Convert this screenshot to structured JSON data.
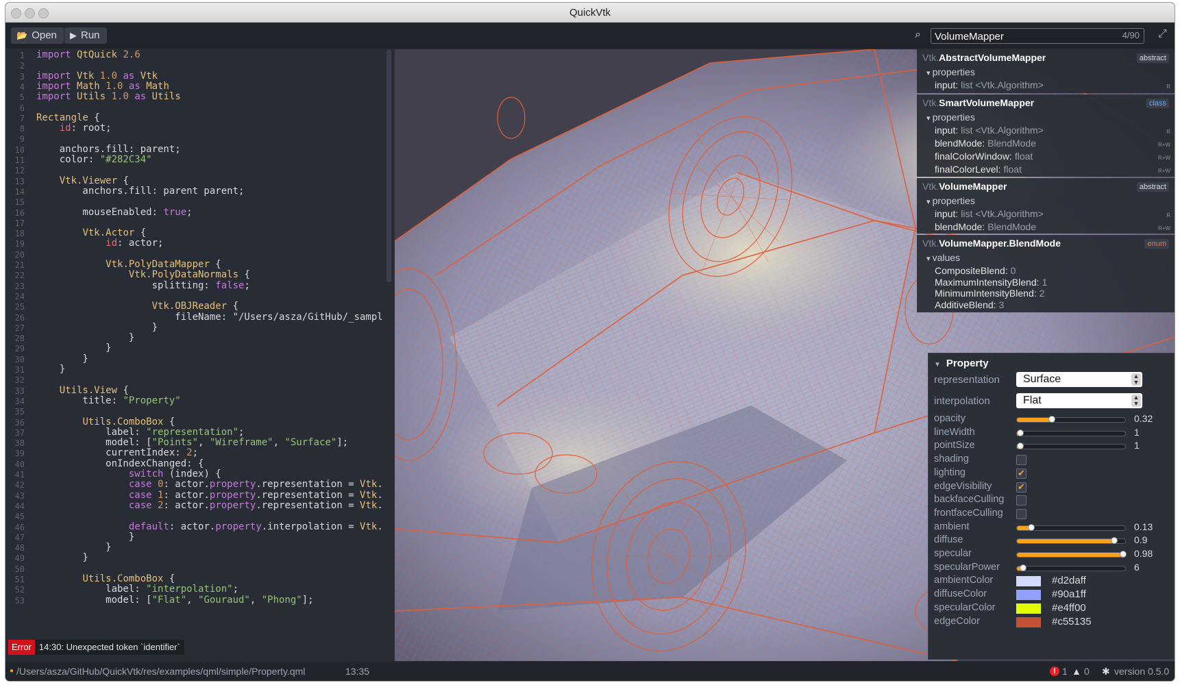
{
  "window": {
    "title": "QuickVtk"
  },
  "toolbar": {
    "open_label": "Open",
    "run_label": "Run"
  },
  "search": {
    "value": "VolumeMapper",
    "count": "4/90"
  },
  "editor": {
    "lines": [
      "import QtQuick 2.6",
      "",
      "import Vtk 1.0 as Vtk",
      "import Math 1.0 as Math",
      "import Utils 1.0 as Utils",
      "",
      "Rectangle {",
      "    id: root;",
      "",
      "    anchors.fill: parent;",
      "    color: \"#282C34\"",
      "",
      "    Vtk.Viewer {",
      "        anchors.fill: parent parent;",
      "",
      "        mouseEnabled: true;",
      "",
      "        Vtk.Actor {",
      "            id: actor;",
      "",
      "            Vtk.PolyDataMapper {",
      "                Vtk.PolyDataNormals {",
      "                    splitting: false;",
      "",
      "                    Vtk.OBJReader {",
      "                        fileName: \"/Users/asza/GitHub/_sampl",
      "                    }",
      "                }",
      "            }",
      "        }",
      "    }",
      "",
      "    Utils.View {",
      "        title: \"Property\"",
      "",
      "        Utils.ComboBox {",
      "            label: \"representation\";",
      "            model: [\"Points\", \"Wireframe\", \"Surface\"];",
      "            currentIndex: 2;",
      "            onIndexChanged: {",
      "                switch (index) {",
      "                case 0: actor.property.representation = Vtk.",
      "                case 1: actor.property.representation = Vtk.",
      "                case 2: actor.property.representation = Vtk.",
      "",
      "                default: actor.property.interpolation = Vtk.",
      "                }",
      "            }",
      "        }",
      "",
      "        Utils.ComboBox {",
      "            label: \"interpolation\";",
      "            model: [\"Flat\", \"Gouraud\", \"Phong\"];"
    ]
  },
  "error": {
    "label": "Error",
    "message": "14:30: Unexpected token `identifier`"
  },
  "statusbar": {
    "path": "/Users/asza/GitHub/QuickVtk/res/examples/qml/simple/Property.qml",
    "cursor": "13:35",
    "errors": "1",
    "warnings": "0",
    "version": "version 0.5.0"
  },
  "docs": [
    {
      "prefix": "Vtk.",
      "name": "AbstractVolumeMapper",
      "badge": "abstract",
      "badge_color": "#d7dae0",
      "section": "properties",
      "rows": [
        {
          "name": "input:",
          "type": "list <Vtk.Algorithm>",
          "rw": "R"
        }
      ]
    },
    {
      "prefix": "Vtk.",
      "name": "SmartVolumeMapper",
      "badge": "class",
      "badge_color": "#61afef",
      "section": "properties",
      "rows": [
        {
          "name": "input:",
          "type": "list <Vtk.Algorithm>",
          "rw": "R"
        },
        {
          "name": "blendMode:",
          "type": "BlendMode",
          "rw": "R+W"
        },
        {
          "name": "finalColorWindow:",
          "type": "float",
          "rw": "R+W"
        },
        {
          "name": "finalColorLevel:",
          "type": "float",
          "rw": "R+W"
        }
      ]
    },
    {
      "prefix": "Vtk.",
      "name": "VolumeMapper",
      "badge": "abstract",
      "badge_color": "#d7dae0",
      "section": "properties",
      "rows": [
        {
          "name": "input:",
          "type": "list <Vtk.Algorithm>",
          "rw": "R"
        },
        {
          "name": "blendMode:",
          "type": "BlendMode",
          "rw": "R+W"
        }
      ]
    },
    {
      "prefix": "Vtk.",
      "name": "VolumeMapper.BlendMode",
      "badge": "enum",
      "badge_color": "#e8743b",
      "section": "values",
      "rows": [
        {
          "name": "CompositeBlend:",
          "type": "0",
          "rw": ""
        },
        {
          "name": "MaximumIntensityBlend:",
          "type": "1",
          "rw": ""
        },
        {
          "name": "MinimumIntensityBlend:",
          "type": "2",
          "rw": ""
        },
        {
          "name": "AdditiveBlend:",
          "type": "3",
          "rw": ""
        }
      ]
    }
  ],
  "property": {
    "title": "Property",
    "combos": [
      {
        "label": "representation",
        "value": "Surface"
      },
      {
        "label": "interpolation",
        "value": "Flat"
      }
    ],
    "sliders": [
      {
        "label": "opacity",
        "value": "0.32",
        "fraction": 0.32
      },
      {
        "label": "lineWidth",
        "value": "1",
        "fraction": 0.0
      },
      {
        "label": "pointSize",
        "value": "1",
        "fraction": 0.0
      },
      {
        "label": "shading",
        "checkbox": false
      },
      {
        "label": "lighting",
        "checkbox": true
      },
      {
        "label": "edgeVisibility",
        "checkbox": true
      },
      {
        "label": "backfaceCulling",
        "checkbox": false
      },
      {
        "label": "frontfaceCulling",
        "checkbox": false
      },
      {
        "label": "ambient",
        "value": "0.13",
        "fraction": 0.13
      },
      {
        "label": "diffuse",
        "value": "0.9",
        "fraction": 0.9
      },
      {
        "label": "specular",
        "value": "0.98",
        "fraction": 0.98
      },
      {
        "label": "specularPower",
        "value": "6",
        "fraction": 0.06
      }
    ],
    "colors": [
      {
        "label": "ambientColor",
        "value": "#d2daff"
      },
      {
        "label": "diffuseColor",
        "value": "#90a1ff"
      },
      {
        "label": "specularColor",
        "value": "#e4ff00"
      },
      {
        "label": "edgeColor",
        "value": "#c55135"
      }
    ]
  },
  "theme": {
    "accent": "#f9a11b",
    "wire": "#e0603a",
    "background": "#282c34"
  }
}
